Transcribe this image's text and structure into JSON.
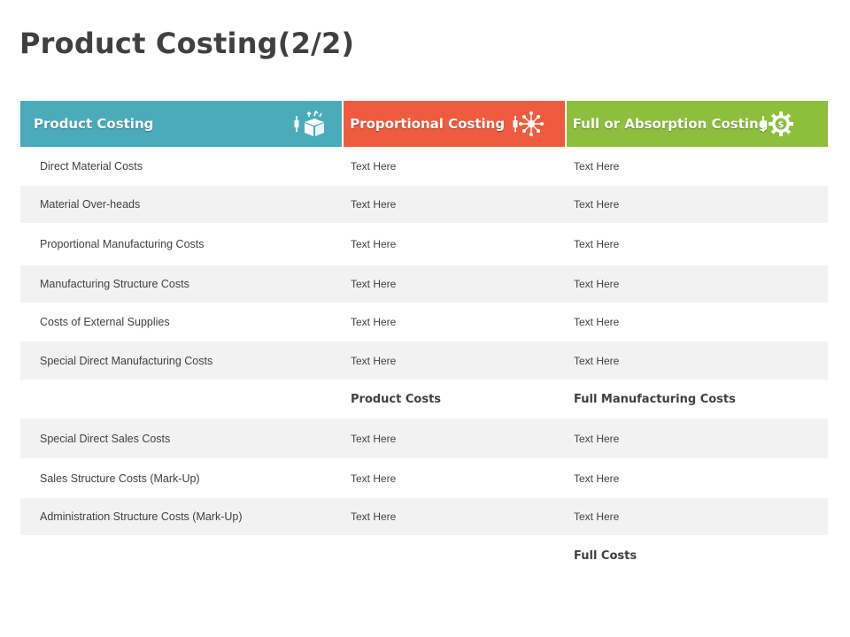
{
  "title": "Product Costing(2/2)",
  "colors": {
    "teal": "#4aabbb",
    "orange": "#ef5b3e",
    "green": "#8dbf3c",
    "row_alt": "#f2f2f2"
  },
  "headers": [
    {
      "label": "Product Costing",
      "icon": "box-icon"
    },
    {
      "label": "Proportional Costing",
      "icon": "network-icon"
    },
    {
      "label": "Full or Absorption Costing",
      "icon": "dollar-gear-icon"
    }
  ],
  "rows": [
    {
      "label": "Direct Material Costs",
      "col2": "Text Here",
      "col3": "Text Here"
    },
    {
      "label": "Material Over-heads",
      "col2": "Text Here",
      "col3": "Text Here"
    },
    {
      "label": "Proportional Manufacturing Costs",
      "col2": "Text Here",
      "col3": "Text Here"
    },
    {
      "label": "Manufacturing Structure Costs",
      "col2": "Text Here",
      "col3": "Text Here"
    },
    {
      "label": "Costs of External Supplies",
      "col2": "Text Here",
      "col3": "Text Here"
    },
    {
      "label": "Special Direct Manufacturing Costs",
      "col2": "Text Here",
      "col3": "Text Here"
    },
    {
      "label": "",
      "col2": "Product Costs",
      "col3": "Full Manufacturing Costs"
    },
    {
      "label": "Special Direct Sales Costs",
      "col2": "Text Here",
      "col3": "Text Here"
    },
    {
      "label": "Sales Structure Costs (Mark-Up)",
      "col2": "Text Here",
      "col3": "Text Here"
    },
    {
      "label": "Administration Structure Costs (Mark-Up)",
      "col2": "Text Here",
      "col3": "Text Here"
    },
    {
      "label": "",
      "col2": "",
      "col3": "Full Costs"
    }
  ]
}
